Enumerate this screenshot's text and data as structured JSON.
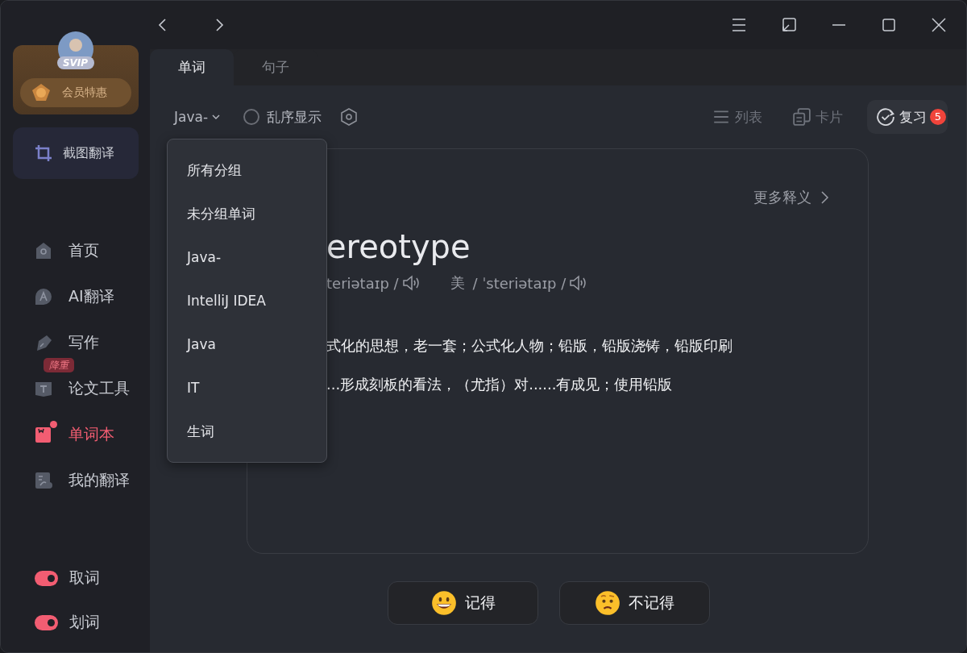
{
  "sidebar": {
    "vip": {
      "badge": "SVIP",
      "offer": "会员特惠"
    },
    "screenshot_translate": "截图翻译",
    "nav": [
      {
        "kind": "home",
        "label": "首页",
        "selected": false,
        "dot": false
      },
      {
        "kind": "ai",
        "label": "AI翻译",
        "selected": false,
        "dot": false
      },
      {
        "kind": "write",
        "label": "写作",
        "selected": false,
        "dot": false
      },
      {
        "kind": "paper",
        "label": "论文工具",
        "selected": false,
        "dot": false,
        "badge": "降重"
      },
      {
        "kind": "wordbook",
        "label": "单词本",
        "selected": true,
        "dot": true
      },
      {
        "kind": "history",
        "label": "我的翻译",
        "selected": false,
        "dot": false
      }
    ],
    "toggles": [
      {
        "label": "取词",
        "on": true
      },
      {
        "label": "划词",
        "on": true
      }
    ]
  },
  "tabs": [
    {
      "label": "单词",
      "selected": true
    },
    {
      "label": "句子",
      "selected": false
    }
  ],
  "toolbar": {
    "group": "Java-",
    "shuffle": {
      "label": "乱序显示",
      "checked": false
    },
    "views": [
      {
        "kind": "list",
        "label": "列表",
        "selected": false
      },
      {
        "kind": "card",
        "label": "卡片",
        "selected": false
      },
      {
        "kind": "review",
        "label": "复习",
        "selected": true,
        "count": "5"
      }
    ]
  },
  "group_menu": [
    "所有分组",
    "未分组单词",
    "Java-",
    "IntelliJ IDEA",
    "Java",
    "IT",
    "生词"
  ],
  "card": {
    "more": "更多释义",
    "word": "ereotype",
    "phonetics": [
      {
        "text": "teriətaɪp /"
      },
      {
        "region": "美",
        "text": "/ ˈsteriətaɪp /"
      }
    ],
    "definitions": [
      "式化的思想，老一套；公式化人物；铅版，铅版浇铸，铅版印刷",
      "...形成刻板的看法，（尤指）对......有成见；使用铅版"
    ]
  },
  "answers": [
    {
      "kind": "remember",
      "label": "记得"
    },
    {
      "kind": "forget",
      "label": "不记得"
    }
  ]
}
